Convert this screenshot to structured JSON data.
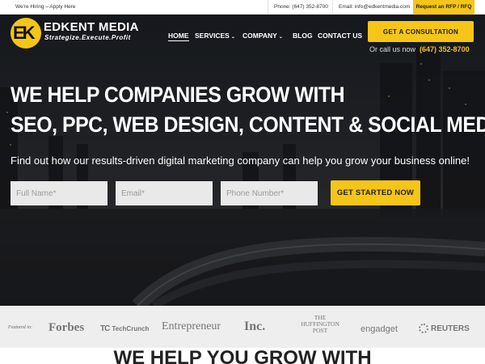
{
  "topbar": {
    "hiring": "We're Hiring – Apply Here",
    "phone": "Phone: (647) 352-8700",
    "email": "Email: info@edkentmedia.com",
    "rfp": "Request an RFP / RFQ"
  },
  "logo": {
    "badge": "EK",
    "name": "EDKENT MEDIA",
    "tagline": "Strategize.Execute.Profit"
  },
  "nav": {
    "home": "HOME",
    "services": "SERVICES",
    "company": "COMPANY",
    "blog": "BLOG",
    "contact": "CONTACT US",
    "chevron": "⌄"
  },
  "header_cta": {
    "consult": "GET A CONSULTATION",
    "callus": "Or call us now",
    "phone": "(647) 352-8700"
  },
  "hero": {
    "line1": "WE HELP COMPANIES GROW WITH",
    "line2": "SEO, PPC, WEB DESIGN, CONTENT & SOCIAL MEDIA",
    "subtitle": "Find out how our results-driven digital marketing company can help you grow your business online!"
  },
  "form": {
    "name_placeholder": "Full Name*",
    "email_placeholder": "Email*",
    "phone_placeholder": "Phone Number*",
    "submit": "GET STARTED NOW"
  },
  "featured": {
    "label": "Featured in:",
    "brands": {
      "forbes": "Forbes",
      "techcrunch_mark": "TC",
      "techcrunch": "TechCrunch",
      "entrepreneur": "Entrepreneur",
      "inc": "Inc.",
      "huffington": "THE HUFFINGTON POST",
      "engadget": "engadget",
      "reuters": "REUTERS"
    }
  },
  "bottom_heading": "WE HELP YOU GROW WITH",
  "colors": {
    "accent": "#f5c518",
    "hero_overlay": "#23262c"
  }
}
